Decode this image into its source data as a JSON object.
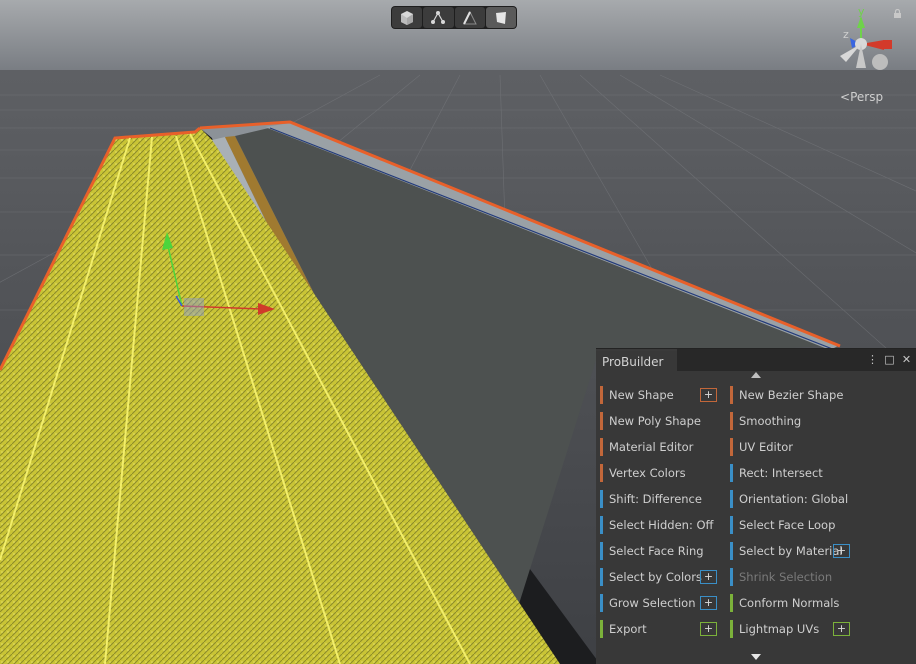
{
  "toolbar": {
    "modes": [
      {
        "name": "object-mode",
        "icon": "cube-icon"
      },
      {
        "name": "vertex-mode",
        "icon": "vertex-icon"
      },
      {
        "name": "edge-mode",
        "icon": "edge-icon"
      },
      {
        "name": "face-mode",
        "icon": "face-icon",
        "active": true
      }
    ]
  },
  "gizmo": {
    "y_label": "y",
    "z_label": "z",
    "projection_label": "Persp"
  },
  "probuilder": {
    "title": "ProBuilder",
    "title_icons": [
      "more-options-icon",
      "maximize-icon",
      "close-icon"
    ],
    "colors": {
      "orange": "#c2673a",
      "blue": "#3a8fc7",
      "green": "#7bb13a"
    },
    "left_column": [
      {
        "label": "New Shape",
        "color": "orange",
        "plus": true
      },
      {
        "label": "New Poly Shape",
        "color": "orange"
      },
      {
        "label": "Material Editor",
        "color": "orange"
      },
      {
        "label": "Vertex Colors",
        "color": "orange"
      },
      {
        "label": "Shift: Difference",
        "color": "blue"
      },
      {
        "label": "Select Hidden: Off",
        "color": "blue"
      },
      {
        "label": "Select Face Ring",
        "color": "blue"
      },
      {
        "label": "Select by Colors",
        "color": "blue",
        "plus": true
      },
      {
        "label": "Grow Selection",
        "color": "blue",
        "plus": true
      },
      {
        "label": "Export",
        "color": "green",
        "plus": true
      }
    ],
    "right_column": [
      {
        "label": "New Bezier Shape",
        "color": "orange"
      },
      {
        "label": "Smoothing",
        "color": "orange"
      },
      {
        "label": "UV Editor",
        "color": "orange"
      },
      {
        "label": "Rect: Intersect",
        "color": "blue"
      },
      {
        "label": "Orientation: Global",
        "color": "blue"
      },
      {
        "label": "Select Face Loop",
        "color": "blue"
      },
      {
        "label": "Select by Material",
        "color": "blue",
        "plus": true
      },
      {
        "label": "Shrink Selection",
        "color": "blue",
        "disabled": true
      },
      {
        "label": "Conform Normals",
        "color": "green"
      },
      {
        "label": "Lightmap UVs",
        "color": "green",
        "plus": true
      }
    ]
  }
}
